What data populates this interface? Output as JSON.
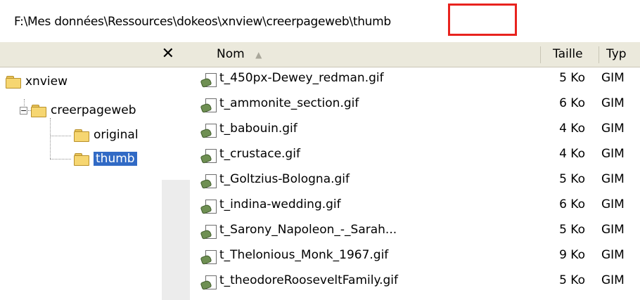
{
  "path": "F:\\Mes données\\Ressources\\dokeos\\xnview\\creerpageweb\\thumb",
  "folders_pane": {
    "close_symbol": "✕",
    "tree": [
      {
        "label": "xnview",
        "expander": ""
      },
      {
        "label": "creerpageweb",
        "expander": "⊟"
      },
      {
        "label": "original",
        "expander": ""
      },
      {
        "label": "thumb",
        "expander": "",
        "selected": true
      }
    ]
  },
  "list": {
    "columns": {
      "name": "Nom",
      "sort_indicator": "▲",
      "size": "Taille",
      "type": "Typ"
    },
    "files": [
      {
        "name": "t_450px-Dewey_redman.gif",
        "size": "5 Ko",
        "type": "GIM"
      },
      {
        "name": "t_ammonite_section.gif",
        "size": "6 Ko",
        "type": "GIM"
      },
      {
        "name": "t_babouin.gif",
        "size": "4 Ko",
        "type": "GIM"
      },
      {
        "name": "t_crustace.gif",
        "size": "4 Ko",
        "type": "GIM"
      },
      {
        "name": "t_Goltzius-Bologna.gif",
        "size": "5 Ko",
        "type": "GIM"
      },
      {
        "name": "t_indina-wedding.gif",
        "size": "6 Ko",
        "type": "GIM"
      },
      {
        "name": "t_Sarony_Napoleon_-_Sarah...",
        "size": "5 Ko",
        "type": "GIM"
      },
      {
        "name": "t_Thelonious_Monk_1967.gif",
        "size": "9 Ko",
        "type": "GIM"
      },
      {
        "name": "t_theodoreRooseveltFamily.gif",
        "size": "5 Ko",
        "type": "GIM"
      }
    ]
  },
  "colors": {
    "highlight_box": "#e8231e",
    "selection": "#316ac5",
    "header_bg": "#ebe9dc"
  }
}
